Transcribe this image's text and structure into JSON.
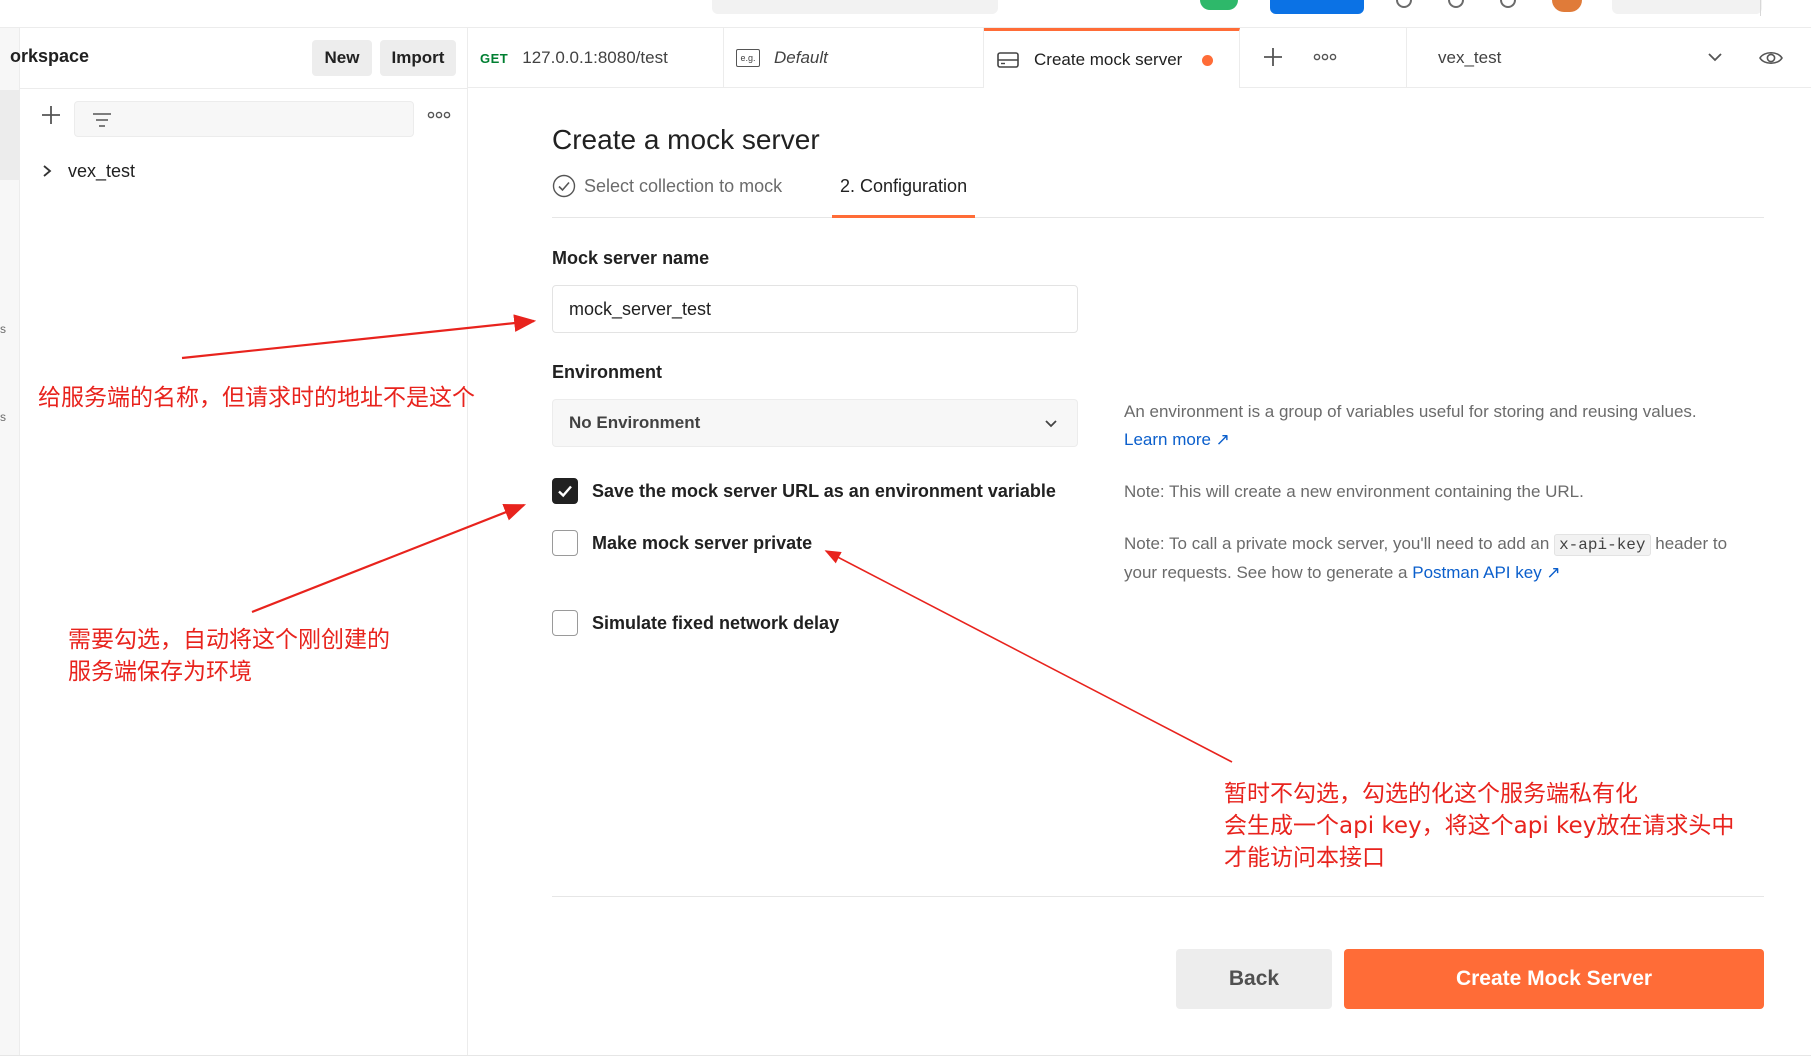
{
  "sidebar": {
    "workspace_title": "orkspace",
    "new_label": "New",
    "import_label": "Import",
    "strip_letters": [
      "s",
      "s"
    ],
    "tree_items": [
      {
        "label": "vex_test"
      }
    ]
  },
  "tabs": {
    "get_method": "GET",
    "get_url": "127.0.0.1:8080/test",
    "env_tab_icon_label": "e.g.",
    "env_tab_label": "Default",
    "mock_tab_label": "Create mock server",
    "environment_selector": "vex_test"
  },
  "main": {
    "title": "Create a mock server",
    "steps": {
      "step1": "Select collection to mock",
      "step2": "2. Configuration"
    },
    "name_label": "Mock server name",
    "name_value": "mock_server_test",
    "environment_label": "Environment",
    "environment_value": "No Environment",
    "checkboxes": {
      "save_url": {
        "label": "Save the mock server URL as an environment variable",
        "checked": true
      },
      "private": {
        "label": "Make mock server private",
        "checked": false
      },
      "delay": {
        "label": "Simulate fixed network delay",
        "checked": false
      }
    },
    "help": {
      "env_text": "An environment is a group of variables useful for storing and reusing values.",
      "learn_more": "Learn more ↗",
      "note1": "Note: This will create a new environment containing the URL.",
      "note2_prefix": "Note: To call a private mock server, you'll need to add an",
      "note2_code": "x-api-key",
      "note2_suffix": "header to your requests. See how to generate a",
      "api_key_link": "Postman API key ↗"
    },
    "back_label": "Back",
    "create_label": "Create Mock Server"
  },
  "annotations": {
    "name_note": "给服务端的名称，但请求时的地址不是这个",
    "save_note_line1": "需要勾选，自动将这个刚创建的",
    "save_note_line2": "服务端保存为环境",
    "private_note_line1": "暂时不勾选，勾选的化这个服务端私有化",
    "private_note_line2": "会生成一个api key，将这个api key放在请求头中",
    "private_note_line3": "才能访问本接口"
  },
  "colors": {
    "accent": "#ff6c37",
    "link": "#0b5fcc",
    "annotation": "#e8231d",
    "get_method": "#007f31"
  }
}
